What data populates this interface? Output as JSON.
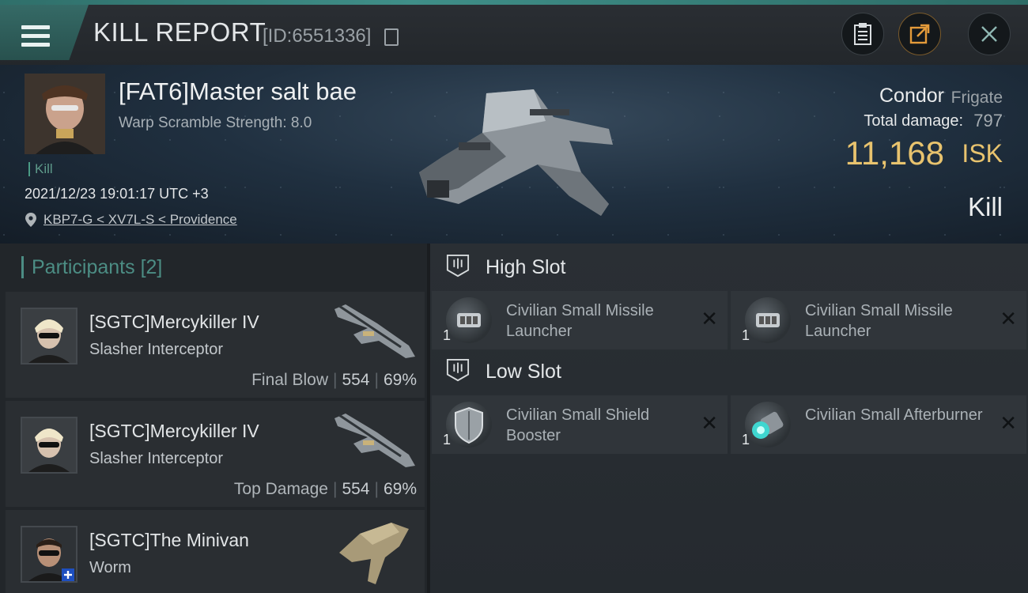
{
  "header": {
    "title": "KILL REPORT",
    "report_id": "[ID:6551336]"
  },
  "victim": {
    "name": "[FAT6]Master salt bae",
    "warp_scramble": "Warp Scramble Strength: 8.0",
    "tag": "Kill",
    "datetime": "2021/12/23 19:01:17 UTC +3",
    "location": "KBP7-G < XV7L-S < Providence",
    "ship_name": "Condor",
    "ship_class": "Frigate",
    "total_damage_label": "Total damage:",
    "total_damage": "797",
    "isk_value": "11,168",
    "isk_unit": "ISK",
    "result": "Kill"
  },
  "participants": {
    "title": "Participants",
    "count": "[2]",
    "items": [
      {
        "name": "[SGTC]Mercykiller IV",
        "ship": "Slasher Interceptor",
        "label": "Final Blow",
        "damage": "554",
        "percent": "69%"
      },
      {
        "name": "[SGTC]Mercykiller IV",
        "ship": "Slasher Interceptor",
        "label": "Top Damage",
        "damage": "554",
        "percent": "69%"
      },
      {
        "name": "[SGTC]The Minivan",
        "ship": "Worm",
        "label": "",
        "damage": "",
        "percent": ""
      }
    ]
  },
  "slots": {
    "high": {
      "title": "High Slot",
      "modules": [
        {
          "qty": "1",
          "name": "Civilian Small Missile Launcher",
          "icon": "missile-launcher-icon"
        },
        {
          "qty": "1",
          "name": "Civilian Small Missile Launcher",
          "icon": "missile-launcher-icon"
        }
      ]
    },
    "low": {
      "title": "Low Slot",
      "modules": [
        {
          "qty": "1",
          "name": "Civilian Small Shield Booster",
          "icon": "shield-booster-icon"
        },
        {
          "qty": "1",
          "name": "Civilian Small Afterburner",
          "icon": "afterburner-icon"
        }
      ]
    }
  },
  "colors": {
    "accent_teal": "#4c8d84",
    "isk_gold": "#e8c36e"
  },
  "close_glyph": "✕"
}
